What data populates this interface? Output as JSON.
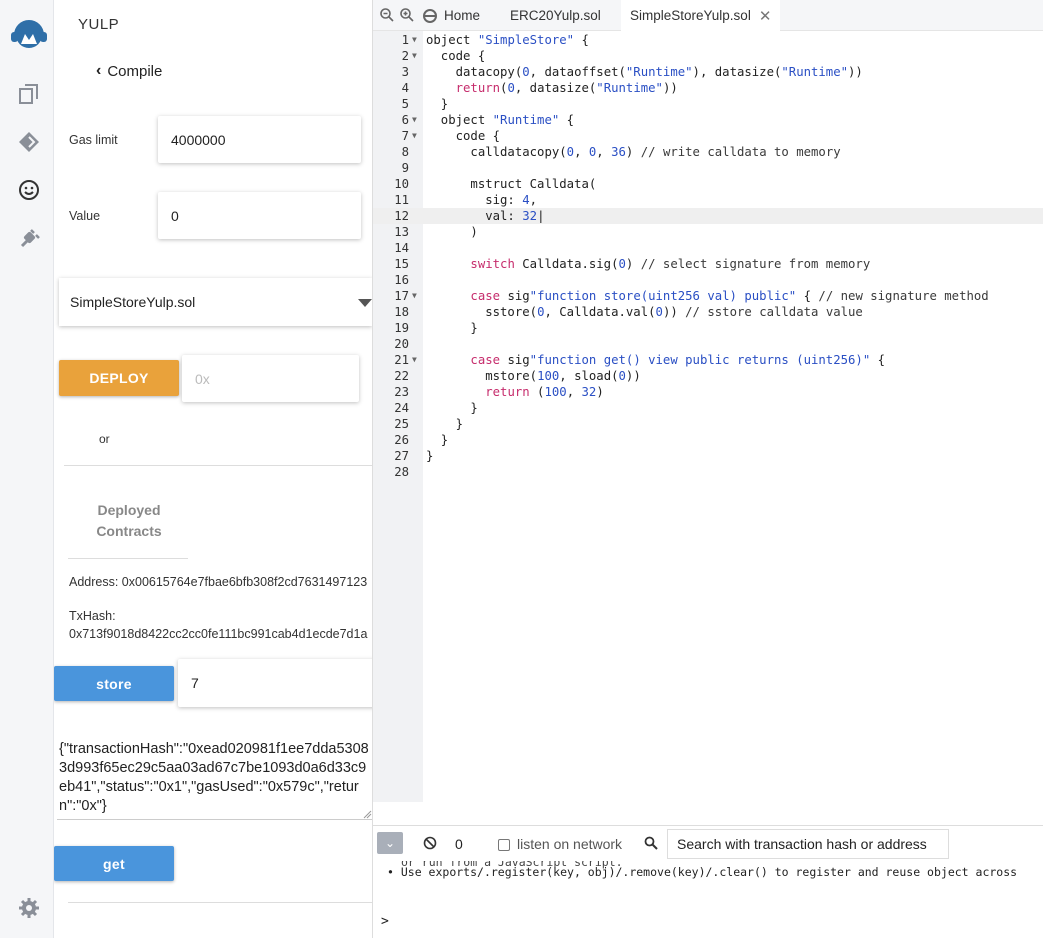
{
  "sidebar": {
    "title": "YULP",
    "back_label": "Compile",
    "gas_limit": {
      "label": "Gas limit",
      "value": "4000000"
    },
    "value_field": {
      "label": "Value",
      "value": "0"
    },
    "contract_select": "SimpleStoreYulp.sol",
    "deploy": {
      "label": "DEPLOY",
      "address_placeholder": "0x"
    },
    "or_label": "or",
    "deployed_heading": "Deployed Contracts",
    "address_text": "Address: 0x00615764e7fbae6bfb308f2cd7631497123",
    "txhash_label": "TxHash:",
    "txhash_value": "0x713f9018d8422cc2cc0fe111bc991cab4d1ecde7d1a",
    "store": {
      "label": "store",
      "value": "7"
    },
    "result_text": "{\"transactionHash\":\"0xead020981f1ee7dda53083d993f65ec29c5aa03ad67c7be1093d0a6d33c9eb41\",\"status\":\"0x1\",\"gasUsed\":\"0x579c\",\"return\":\"0x\"}",
    "get_label": "get"
  },
  "rail_icons": [
    "remix-logo-icon",
    "file-explorer-icon",
    "deploy-icon",
    "smiley-icon",
    "plugin-icon",
    "settings-icon"
  ],
  "tabs": [
    {
      "label": "Home"
    },
    {
      "label": "ERC20Yulp.sol"
    },
    {
      "label": "SimpleStoreYulp.sol",
      "active": true
    }
  ],
  "editor": {
    "active_line": 12,
    "lines": [
      [
        {
          "t": "object "
        },
        {
          "s": "\"SimpleStore\""
        },
        {
          "t": " {"
        }
      ],
      [
        {
          "t": "  code {"
        }
      ],
      [
        {
          "t": "    datacopy("
        },
        {
          "n": "0"
        },
        {
          "t": ", dataoffset("
        },
        {
          "s": "\"Runtime\""
        },
        {
          "t": "), datasize("
        },
        {
          "s": "\"Runtime\""
        },
        {
          "t": "))"
        }
      ],
      [
        {
          "t": "    "
        },
        {
          "k": "return"
        },
        {
          "t": "("
        },
        {
          "n": "0"
        },
        {
          "t": ", datasize("
        },
        {
          "s": "\"Runtime\""
        },
        {
          "t": "))"
        }
      ],
      [
        {
          "t": "  }"
        }
      ],
      [
        {
          "t": "  object "
        },
        {
          "s": "\"Runtime\""
        },
        {
          "t": " {"
        }
      ],
      [
        {
          "t": "    code {"
        }
      ],
      [
        {
          "t": "      calldatacopy("
        },
        {
          "n": "0"
        },
        {
          "t": ", "
        },
        {
          "n": "0"
        },
        {
          "t": ", "
        },
        {
          "n": "36"
        },
        {
          "t": ") "
        },
        {
          "c": "// write calldata to memory"
        }
      ],
      [],
      [
        {
          "t": "      mstruct Calldata("
        }
      ],
      [
        {
          "t": "        sig: "
        },
        {
          "n": "4"
        },
        {
          "t": ","
        }
      ],
      [
        {
          "t": "        val: "
        },
        {
          "n": "32"
        },
        {
          "t": "|"
        }
      ],
      [
        {
          "t": "      )"
        }
      ],
      [],
      [
        {
          "t": "      "
        },
        {
          "k": "switch"
        },
        {
          "t": " Calldata.sig("
        },
        {
          "n": "0"
        },
        {
          "t": ") "
        },
        {
          "c": "// select signature from memory"
        }
      ],
      [],
      [
        {
          "t": "      "
        },
        {
          "k": "case"
        },
        {
          "t": " sig"
        },
        {
          "s": "\"function store(uint256 val) public\""
        },
        {
          "t": " { "
        },
        {
          "c": "// new signature method"
        }
      ],
      [
        {
          "t": "        sstore("
        },
        {
          "n": "0"
        },
        {
          "t": ", Calldata.val("
        },
        {
          "n": "0"
        },
        {
          "t": ")) "
        },
        {
          "c": "// sstore calldata value"
        }
      ],
      [
        {
          "t": "      }"
        }
      ],
      [],
      [
        {
          "t": "      "
        },
        {
          "k": "case"
        },
        {
          "t": " sig"
        },
        {
          "s": "\"function get() view public returns (uint256)\""
        },
        {
          "t": " {"
        }
      ],
      [
        {
          "t": "        mstore("
        },
        {
          "n": "100"
        },
        {
          "t": ", sload("
        },
        {
          "n": "0"
        },
        {
          "t": "))"
        }
      ],
      [
        {
          "t": "        "
        },
        {
          "k": "return"
        },
        {
          "t": " ("
        },
        {
          "n": "100"
        },
        {
          "t": ", "
        },
        {
          "n": "32"
        },
        {
          "t": ")"
        }
      ],
      [
        {
          "t": "      }"
        }
      ],
      [
        {
          "t": "    }"
        }
      ],
      [
        {
          "t": "  }"
        }
      ],
      [
        {
          "t": "}"
        }
      ],
      []
    ],
    "fold_lines": [
      1,
      2,
      6,
      7,
      17,
      21
    ]
  },
  "terminal": {
    "count": "0",
    "listen_label": "listen on network",
    "search_placeholder": "Search with transaction hash or address",
    "cut_line": "or run from a JavaScript script.",
    "bullet_line": "Use exports/.register(key, obj)/.remove(key)/.clear() to register and reuse object across",
    "prompt": ">"
  }
}
